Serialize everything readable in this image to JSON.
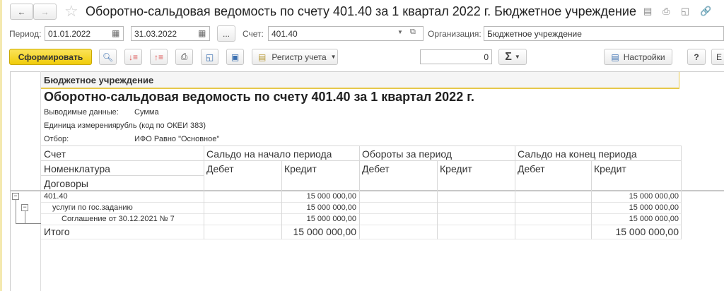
{
  "window": {
    "title": "Оборотно-сальдовая ведомость по счету 401.40 за 1 квартал 2022 г. Бюджетное учреждение"
  },
  "filters": {
    "period_label": "Период:",
    "date_from": "01.01.2022",
    "date_to": "31.03.2022",
    "ellipsis": "...",
    "account_label": "Счет:",
    "account": "401.40",
    "org_label": "Организация:",
    "org": "Бюджетное учреждение"
  },
  "toolbar": {
    "generate": "Сформировать",
    "register": "Регистр учета",
    "sum_value": "0",
    "sigma": "Σ",
    "settings": "Настройки",
    "help": "?",
    "more": "Е"
  },
  "report": {
    "org": "Бюджетное учреждение",
    "title": "Оборотно-сальдовая ведомость по счету 401.40 за 1 квартал 2022 г.",
    "meta": [
      {
        "label": "Выводимые данные:",
        "value": "Сумма"
      },
      {
        "label": "Единица измерения:",
        "value": "рубль (код по ОКЕИ 383)"
      },
      {
        "label": "Отбор:",
        "value": "ИФО Равно \"Основное\""
      }
    ],
    "headers": {
      "col1": [
        "Счет",
        "Номенклатура",
        "Договоры"
      ],
      "opening": "Сальдо на начало периода",
      "turnover": "Обороты за период",
      "closing": "Сальдо на конец периода",
      "debit": "Дебет",
      "credit": "Кредит"
    },
    "rows": [
      {
        "name": "401.40",
        "open_credit": "15 000 000,00",
        "close_credit": "15 000 000,00"
      },
      {
        "name": "услуги по гос.заданию",
        "open_credit": "15 000 000,00",
        "close_credit": "15 000 000,00"
      },
      {
        "name": "Соглашение от 30.12.2021 № 7",
        "open_credit": "15 000 000,00",
        "close_credit": "15 000 000,00"
      }
    ],
    "total": {
      "label": "Итого",
      "open_credit": "15 000 000,00",
      "close_credit": "15 000 000,00"
    }
  }
}
